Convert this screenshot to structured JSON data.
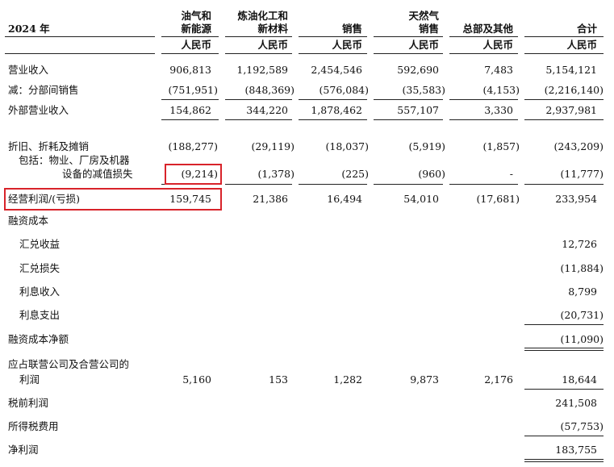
{
  "header": {
    "year": "2024 年",
    "columns": [
      {
        "line1": "油气和",
        "line2": "新能源",
        "currency": "人民币"
      },
      {
        "line1": "炼油化工和",
        "line2": "新材料",
        "currency": "人民币"
      },
      {
        "line1": "",
        "line2": "销售",
        "currency": "人民币"
      },
      {
        "line1": "天然气",
        "line2": "销售",
        "currency": "人民币"
      },
      {
        "line1": "",
        "line2": "总部及其他",
        "currency": "人民币"
      },
      {
        "line1": "",
        "line2": "合计",
        "currency": "人民币"
      }
    ]
  },
  "rows": {
    "revenue": {
      "label": "营业收入",
      "v": [
        "906,813",
        "1,192,589",
        "2,454,546",
        "592,690",
        "7,483",
        "5,154,121"
      ]
    },
    "inter_segment": {
      "label": "减：分部间销售",
      "v": [
        "(751,951)",
        "(848,369)",
        "(576,084)",
        "(35,583)",
        "(4,153)",
        "(2,216,140)"
      ]
    },
    "external_revenue": {
      "label": "外部营业收入",
      "v": [
        "154,862",
        "344,220",
        "1,878,462",
        "557,107",
        "3,330",
        "2,937,981"
      ]
    },
    "depreciation": {
      "label": "折旧、折耗及摊销",
      "v": [
        "(188,277)",
        "(29,119)",
        "(18,037)",
        "(5,919)",
        "(1,857)",
        "(243,209)"
      ]
    },
    "impairment": {
      "label1": "包括：物业、厂房及机器",
      "label2": "设备的减值损失",
      "v": [
        "(9,214)",
        "(1,378)",
        "(225)",
        "(960)",
        "-",
        "(11,777)"
      ]
    },
    "operating_profit": {
      "label": "经营利润/(亏损)",
      "v": [
        "159,745",
        "21,386",
        "16,494",
        "54,010",
        "(17,681)",
        "233,954"
      ]
    },
    "finance_cost_title": {
      "label": "融资成本"
    },
    "fx_gain": {
      "label": "汇兑收益",
      "total": "12,726"
    },
    "fx_loss": {
      "label": "汇兑损失",
      "total": "(11,884)"
    },
    "interest_income": {
      "label": "利息收入",
      "total": "8,799"
    },
    "interest_expense": {
      "label": "利息支出",
      "total": "(20,731)"
    },
    "net_finance_cost": {
      "label": "融资成本净额",
      "total": "(11,090)"
    },
    "share_of_profit": {
      "label1": "应占联营公司及合营公司的",
      "label2": "利润",
      "v": [
        "5,160",
        "153",
        "1,282",
        "9,873",
        "2,176",
        "18,644"
      ]
    },
    "profit_before_tax": {
      "label": "税前利润",
      "total": "241,508"
    },
    "income_tax": {
      "label": "所得税费用",
      "total": "(57,753)"
    },
    "net_profit": {
      "label": "净利润",
      "total": "183,755"
    }
  }
}
